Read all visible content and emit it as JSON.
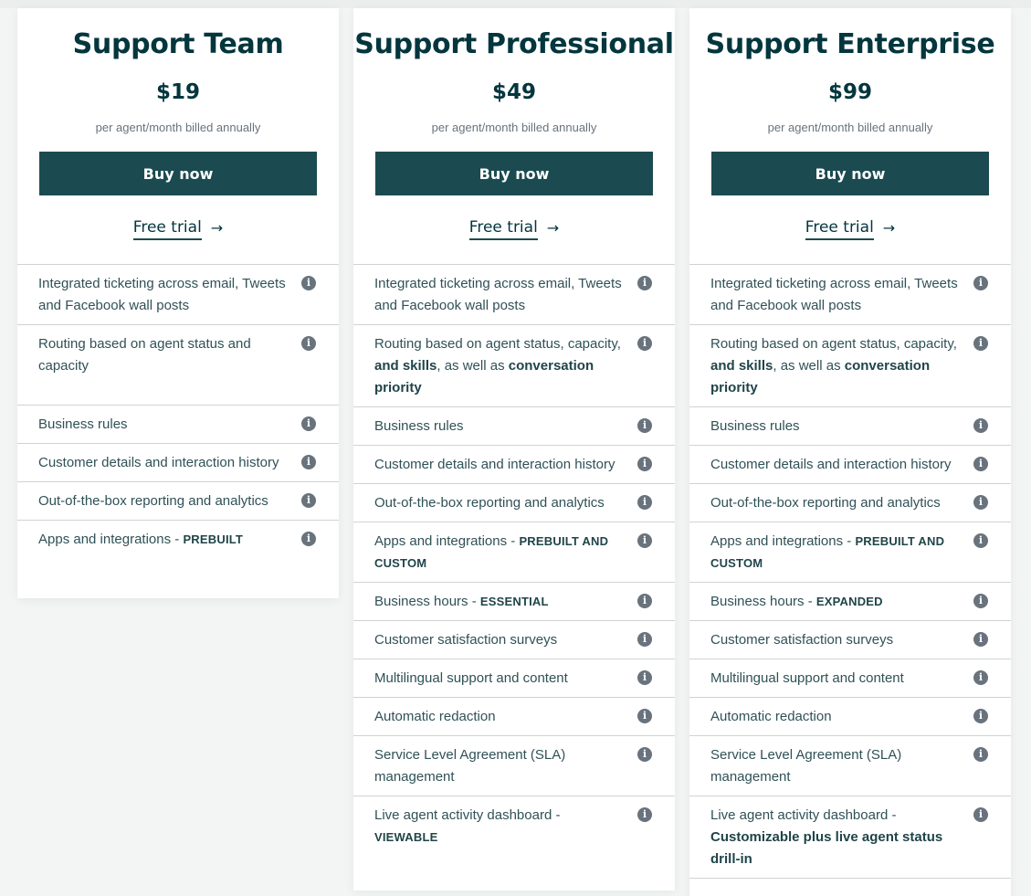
{
  "colors": {
    "brand_dark": "#03363d",
    "button_bg": "#1b4b50",
    "text": "#2f5157",
    "muted": "#68737d",
    "divider": "#cfd3d5",
    "page_bg": "#f3f4f4"
  },
  "plans": [
    {
      "title": "Support Team",
      "price": "$19",
      "billing": "per agent/month billed annually",
      "buy_label": "Buy now",
      "trial_label": "Free trial",
      "trial_icon": "arrow-right-icon",
      "features": [
        {
          "text": "Integrated ticketing across email, Tweets and Facebook wall posts"
        },
        {
          "text": "Routing based on agent status and capacity"
        },
        {
          "text": "Business rules"
        },
        {
          "text": "Customer details and interaction history"
        },
        {
          "text": "Out-of-the-box reporting and analytics"
        },
        {
          "text": "Apps and integrations - ",
          "bold": "PREBUILT"
        }
      ]
    },
    {
      "title": "Support Professional",
      "price": "$49",
      "billing": "per agent/month billed annually",
      "buy_label": "Buy now",
      "trial_label": "Free trial",
      "trial_icon": "arrow-right-icon",
      "features": [
        {
          "text": "Integrated ticketing across email, Tweets and Facebook wall posts"
        },
        {
          "text": "Routing based on agent status, capacity, ",
          "bold": "and skills",
          "text2": ", as well as ",
          "bold2": "conversation priority"
        },
        {
          "text": "Business rules"
        },
        {
          "text": "Customer details and interaction history"
        },
        {
          "text": "Out-of-the-box reporting and analytics"
        },
        {
          "text": "Apps and integrations - ",
          "bold": "PREBUILT AND CUSTOM"
        },
        {
          "text": "Business hours - ",
          "bold": "ESSENTIAL"
        },
        {
          "text": "Customer satisfaction surveys"
        },
        {
          "text": "Multilingual support and content"
        },
        {
          "text": "Automatic redaction"
        },
        {
          "text": "Service Level Agreement (SLA) management"
        },
        {
          "text": "Live agent activity dashboard - ",
          "bold": "VIEWABLE"
        }
      ]
    },
    {
      "title": "Support Enterprise",
      "price": "$99",
      "billing": "per agent/month billed annually",
      "buy_label": "Buy now",
      "trial_label": "Free trial",
      "trial_icon": "arrow-right-icon",
      "features": [
        {
          "text": "Integrated ticketing across email, Tweets and Facebook wall posts"
        },
        {
          "text": "Routing based on agent status, capacity, ",
          "bold": "and skills",
          "text2": ", as well as ",
          "bold2": "conversation priority"
        },
        {
          "text": "Business rules"
        },
        {
          "text": "Customer details and interaction history"
        },
        {
          "text": "Out-of-the-box reporting and analytics"
        },
        {
          "text": "Apps and integrations - ",
          "bold": "PREBUILT AND CUSTOM"
        },
        {
          "text": "Business hours - ",
          "bold": "EXPANDED"
        },
        {
          "text": "Customer satisfaction surveys"
        },
        {
          "text": "Multilingual support and content"
        },
        {
          "text": "Automatic redaction"
        },
        {
          "text": "Service Level Agreement (SLA) management"
        },
        {
          "text": "Live agent activity dashboard - ",
          "bold": "Customizable plus live agent status drill-in"
        }
      ]
    }
  ],
  "info_glyph": "i"
}
